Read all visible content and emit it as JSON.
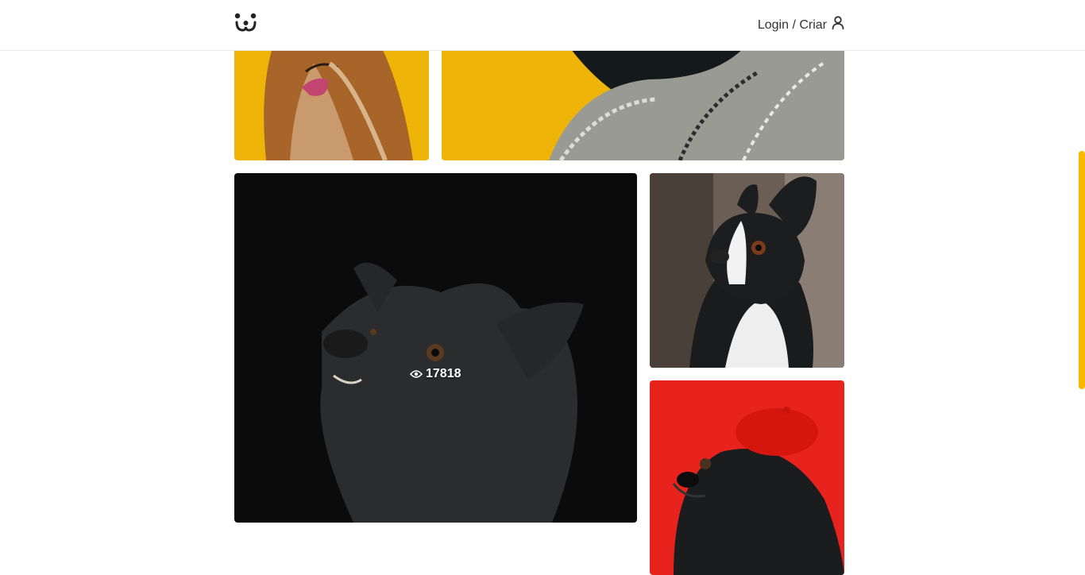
{
  "header": {
    "logo_icon": "dog-face-icon",
    "login_label": "Login / Criar",
    "user_icon": "user-icon"
  },
  "feed": {
    "photos": [
      {
        "subject": "long-haired dog on yellow background",
        "bg": "#efb408"
      },
      {
        "subject": "black dog in knitted sweater on yellow background",
        "bg": "#efb408"
      },
      {
        "subject": "black dog on dark background",
        "bg": "#0b0b0b",
        "views": "17818",
        "views_icon": "eye-icon"
      },
      {
        "subject": "boston terrier",
        "bg": "#6b5e55"
      },
      {
        "subject": "pug with red beret on red background",
        "bg": "#e8221c"
      }
    ]
  },
  "colors": {
    "accent": "#fbb800",
    "text": "#333333"
  }
}
